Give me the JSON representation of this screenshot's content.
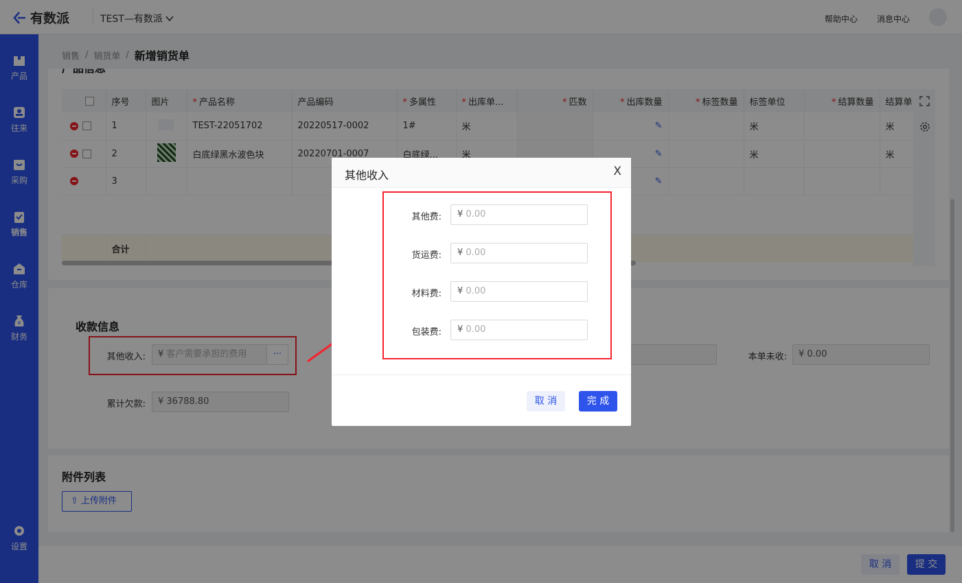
{
  "header": {
    "logo_text": "有数派",
    "company": "TEST—有数派",
    "help": "帮助中心",
    "messages": "消息中心"
  },
  "sidebar": {
    "items": [
      {
        "label": "产品",
        "icon": "box-icon"
      },
      {
        "label": "往来",
        "icon": "contacts-icon"
      },
      {
        "label": "采购",
        "icon": "purchase-icon"
      },
      {
        "label": "销售",
        "icon": "sales-icon"
      },
      {
        "label": "仓库",
        "icon": "warehouse-icon"
      },
      {
        "label": "财务",
        "icon": "finance-icon"
      },
      {
        "label": "设置",
        "icon": "gear-icon"
      }
    ]
  },
  "breadcrumb": {
    "l1": "销售",
    "l2": "销货单",
    "current": "新增销货单"
  },
  "product_section": {
    "title": "产品信息"
  },
  "table": {
    "headers": [
      "序号",
      "图片",
      "产品名称",
      "产品编码",
      "多属性",
      "出库单...",
      "匹数",
      "出库数量",
      "标签数量",
      "标签单位",
      "结算数量",
      "结算单"
    ],
    "rows": [
      {
        "no": "1",
        "name": "TEST-22051702",
        "code": "20220517-0002",
        "attr": "1#",
        "unit": "米",
        "label_unit": "米",
        "settle_unit": "米"
      },
      {
        "no": "2",
        "name": "白底绿黑水波色块",
        "code": "20220701-0007",
        "attr": "白底绿...",
        "unit": "米",
        "label_unit": "米",
        "settle_unit": "米"
      },
      {
        "no": "3",
        "name": "",
        "code": "",
        "attr": "",
        "unit": "",
        "label_unit": "",
        "settle_unit": ""
      }
    ],
    "total_label": "合计"
  },
  "payment": {
    "title": "收款信息",
    "other_income_label": "其他收入:",
    "other_income_prefix": "¥",
    "other_income_placeholder": "客户需要承担的费用",
    "more": "···",
    "arrears_label": "累计欠款:",
    "arrears_value": "¥  36788.80",
    "uncollected_label": "本单未收:",
    "uncollected_value": "¥  0.00"
  },
  "attachments": {
    "title": "附件列表",
    "upload": "上传附件"
  },
  "footer": {
    "cancel": "取 消",
    "submit": "提 交"
  },
  "modal": {
    "title": "其他收入",
    "close": "X",
    "fields": [
      {
        "label": "其他费:",
        "prefix": "¥",
        "placeholder": "0.00"
      },
      {
        "label": "货运费:",
        "prefix": "¥",
        "placeholder": "0.00"
      },
      {
        "label": "材料费:",
        "prefix": "¥",
        "placeholder": "0.00"
      },
      {
        "label": "包装费:",
        "prefix": "¥",
        "placeholder": "0.00"
      }
    ],
    "cancel": "取 消",
    "confirm": "完 成"
  },
  "colors": {
    "accent": "#2f54eb",
    "highlight": "#f5222d"
  }
}
